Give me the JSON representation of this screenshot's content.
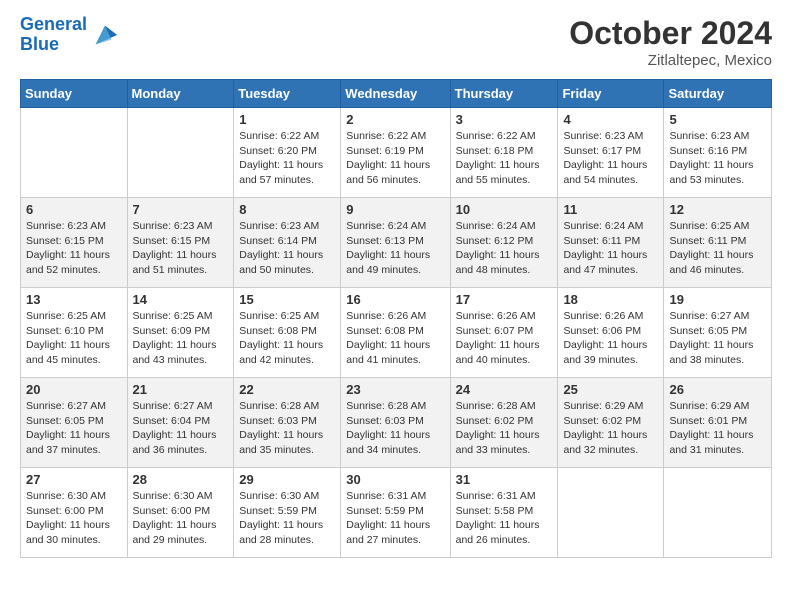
{
  "header": {
    "logo_line1": "General",
    "logo_line2": "Blue",
    "month": "October 2024",
    "location": "Zitlaltepec, Mexico"
  },
  "weekdays": [
    "Sunday",
    "Monday",
    "Tuesday",
    "Wednesday",
    "Thursday",
    "Friday",
    "Saturday"
  ],
  "weeks": [
    [
      {
        "day": "",
        "info": ""
      },
      {
        "day": "",
        "info": ""
      },
      {
        "day": "1",
        "info": "Sunrise: 6:22 AM\nSunset: 6:20 PM\nDaylight: 11 hours and 57 minutes."
      },
      {
        "day": "2",
        "info": "Sunrise: 6:22 AM\nSunset: 6:19 PM\nDaylight: 11 hours and 56 minutes."
      },
      {
        "day": "3",
        "info": "Sunrise: 6:22 AM\nSunset: 6:18 PM\nDaylight: 11 hours and 55 minutes."
      },
      {
        "day": "4",
        "info": "Sunrise: 6:23 AM\nSunset: 6:17 PM\nDaylight: 11 hours and 54 minutes."
      },
      {
        "day": "5",
        "info": "Sunrise: 6:23 AM\nSunset: 6:16 PM\nDaylight: 11 hours and 53 minutes."
      }
    ],
    [
      {
        "day": "6",
        "info": "Sunrise: 6:23 AM\nSunset: 6:15 PM\nDaylight: 11 hours and 52 minutes."
      },
      {
        "day": "7",
        "info": "Sunrise: 6:23 AM\nSunset: 6:15 PM\nDaylight: 11 hours and 51 minutes."
      },
      {
        "day": "8",
        "info": "Sunrise: 6:23 AM\nSunset: 6:14 PM\nDaylight: 11 hours and 50 minutes."
      },
      {
        "day": "9",
        "info": "Sunrise: 6:24 AM\nSunset: 6:13 PM\nDaylight: 11 hours and 49 minutes."
      },
      {
        "day": "10",
        "info": "Sunrise: 6:24 AM\nSunset: 6:12 PM\nDaylight: 11 hours and 48 minutes."
      },
      {
        "day": "11",
        "info": "Sunrise: 6:24 AM\nSunset: 6:11 PM\nDaylight: 11 hours and 47 minutes."
      },
      {
        "day": "12",
        "info": "Sunrise: 6:25 AM\nSunset: 6:11 PM\nDaylight: 11 hours and 46 minutes."
      }
    ],
    [
      {
        "day": "13",
        "info": "Sunrise: 6:25 AM\nSunset: 6:10 PM\nDaylight: 11 hours and 45 minutes."
      },
      {
        "day": "14",
        "info": "Sunrise: 6:25 AM\nSunset: 6:09 PM\nDaylight: 11 hours and 43 minutes."
      },
      {
        "day": "15",
        "info": "Sunrise: 6:25 AM\nSunset: 6:08 PM\nDaylight: 11 hours and 42 minutes."
      },
      {
        "day": "16",
        "info": "Sunrise: 6:26 AM\nSunset: 6:08 PM\nDaylight: 11 hours and 41 minutes."
      },
      {
        "day": "17",
        "info": "Sunrise: 6:26 AM\nSunset: 6:07 PM\nDaylight: 11 hours and 40 minutes."
      },
      {
        "day": "18",
        "info": "Sunrise: 6:26 AM\nSunset: 6:06 PM\nDaylight: 11 hours and 39 minutes."
      },
      {
        "day": "19",
        "info": "Sunrise: 6:27 AM\nSunset: 6:05 PM\nDaylight: 11 hours and 38 minutes."
      }
    ],
    [
      {
        "day": "20",
        "info": "Sunrise: 6:27 AM\nSunset: 6:05 PM\nDaylight: 11 hours and 37 minutes."
      },
      {
        "day": "21",
        "info": "Sunrise: 6:27 AM\nSunset: 6:04 PM\nDaylight: 11 hours and 36 minutes."
      },
      {
        "day": "22",
        "info": "Sunrise: 6:28 AM\nSunset: 6:03 PM\nDaylight: 11 hours and 35 minutes."
      },
      {
        "day": "23",
        "info": "Sunrise: 6:28 AM\nSunset: 6:03 PM\nDaylight: 11 hours and 34 minutes."
      },
      {
        "day": "24",
        "info": "Sunrise: 6:28 AM\nSunset: 6:02 PM\nDaylight: 11 hours and 33 minutes."
      },
      {
        "day": "25",
        "info": "Sunrise: 6:29 AM\nSunset: 6:02 PM\nDaylight: 11 hours and 32 minutes."
      },
      {
        "day": "26",
        "info": "Sunrise: 6:29 AM\nSunset: 6:01 PM\nDaylight: 11 hours and 31 minutes."
      }
    ],
    [
      {
        "day": "27",
        "info": "Sunrise: 6:30 AM\nSunset: 6:00 PM\nDaylight: 11 hours and 30 minutes."
      },
      {
        "day": "28",
        "info": "Sunrise: 6:30 AM\nSunset: 6:00 PM\nDaylight: 11 hours and 29 minutes."
      },
      {
        "day": "29",
        "info": "Sunrise: 6:30 AM\nSunset: 5:59 PM\nDaylight: 11 hours and 28 minutes."
      },
      {
        "day": "30",
        "info": "Sunrise: 6:31 AM\nSunset: 5:59 PM\nDaylight: 11 hours and 27 minutes."
      },
      {
        "day": "31",
        "info": "Sunrise: 6:31 AM\nSunset: 5:58 PM\nDaylight: 11 hours and 26 minutes."
      },
      {
        "day": "",
        "info": ""
      },
      {
        "day": "",
        "info": ""
      }
    ]
  ]
}
